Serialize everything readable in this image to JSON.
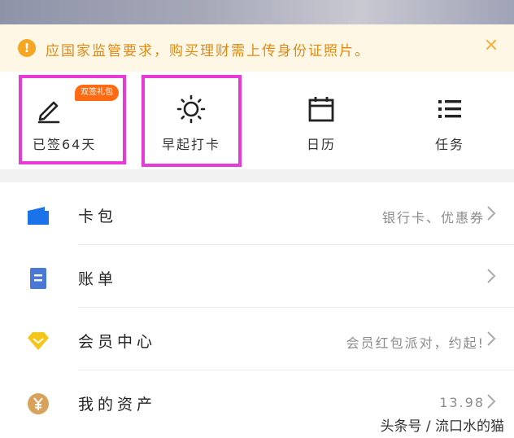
{
  "notice": {
    "icon": "exclamation-icon",
    "text": "应国家监管要求，购买理财需上传身份证照片。",
    "close_icon": "close-icon"
  },
  "quick_actions": [
    {
      "icon": "pen-icon",
      "label": "已签64天",
      "badge": "双签礼包"
    },
    {
      "icon": "sun-icon",
      "label": "早起打卡"
    },
    {
      "icon": "calendar-icon",
      "label": "日历"
    },
    {
      "icon": "list-icon",
      "label": "任务"
    }
  ],
  "menu": [
    {
      "icon": "card-wallet-icon",
      "label": "卡包",
      "sub": "银行卡、优惠券",
      "color": "#1a73e8"
    },
    {
      "icon": "bill-icon",
      "label": "账单",
      "sub": "",
      "color": "#4a78d8"
    },
    {
      "icon": "member-diamond-icon",
      "label": "会员中心",
      "sub": "会员红包派对，约起!",
      "color": "#f5c518"
    },
    {
      "icon": "yuan-coin-icon",
      "label": "我的资产",
      "sub": "13.98",
      "color": "#d9a25a"
    }
  ],
  "watermark": "头条号 / 流口水的猫",
  "colors": {
    "highlight": "#e83ad6",
    "notice_bg": "#fff7e5",
    "notice_text": "#e08a12",
    "badge": "#ff6a13"
  }
}
